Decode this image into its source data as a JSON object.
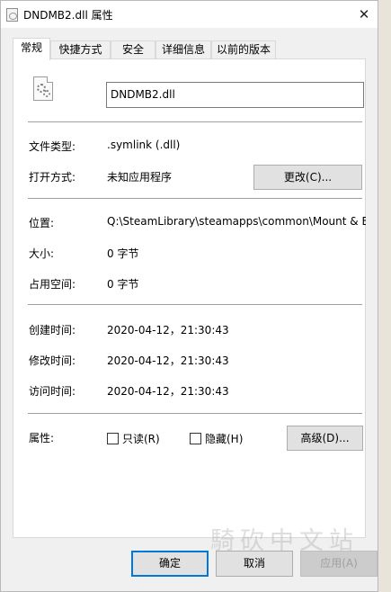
{
  "window": {
    "title": "DNDMB2.dll 属性",
    "close_glyph": "✕"
  },
  "tabs": [
    {
      "label": "常规",
      "active": true
    },
    {
      "label": "快捷方式",
      "active": false
    },
    {
      "label": "安全",
      "active": false
    },
    {
      "label": "详细信息",
      "active": false
    },
    {
      "label": "以前的版本",
      "active": false
    }
  ],
  "general": {
    "file_name": "DNDMB2.dll",
    "file_type_label": "文件类型:",
    "file_type_value": ".symlink (.dll)",
    "open_with_label": "打开方式:",
    "open_with_value": "未知应用程序",
    "change_button": "更改(C)...",
    "location_label": "位置:",
    "location_value": "Q:\\SteamLibrary\\steamapps\\common\\Mount & Blade",
    "size_label": "大小:",
    "size_value": "0 字节",
    "size_on_disk_label": "占用空间:",
    "size_on_disk_value": "0 字节",
    "created_label": "创建时间:",
    "created_value": "2020-04-12，21:30:43",
    "modified_label": "修改时间:",
    "modified_value": "2020-04-12，21:30:43",
    "accessed_label": "访问时间:",
    "accessed_value": "2020-04-12，21:30:43",
    "attributes_label": "属性:",
    "readonly_label": "只读(R)",
    "readonly_checked": false,
    "hidden_label": "隐藏(H)",
    "hidden_checked": false,
    "advanced_button": "高级(D)..."
  },
  "footer": {
    "ok_button": "确定",
    "cancel_button": "取消",
    "apply_button": "应用(A)"
  },
  "watermark": "騎砍中文站"
}
